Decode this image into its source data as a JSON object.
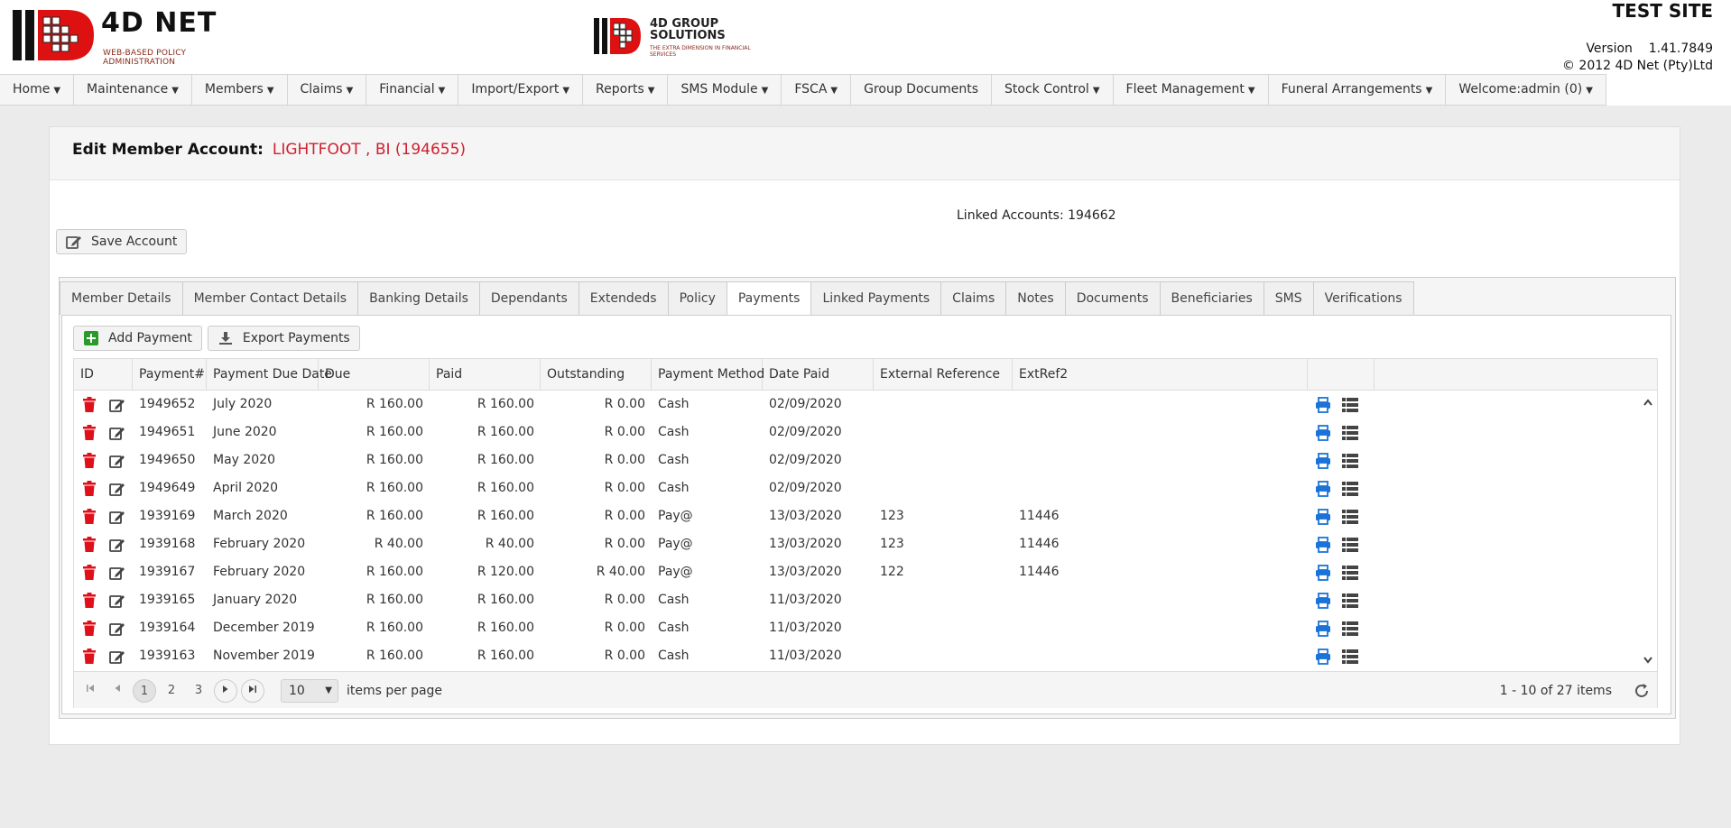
{
  "header": {
    "logo_text": "4D NET",
    "logo_tagline": "WEB-BASED POLICY ADMINISTRATION",
    "logo2_line1": "4D GROUP",
    "logo2_line2": "SOLUTIONS",
    "logo2_tagline": "THE EXTRA DIMENSION IN FINANCIAL SERVICES",
    "site_name": "TEST SITE",
    "version_label": "Version",
    "version_value": "1.41.7849",
    "copyright": "© 2012 4D Net (Pty)Ltd"
  },
  "nav": {
    "items": [
      {
        "label": "Home",
        "dropdown": true
      },
      {
        "label": "Maintenance",
        "dropdown": true
      },
      {
        "label": "Members",
        "dropdown": true
      },
      {
        "label": "Claims",
        "dropdown": true
      },
      {
        "label": "Financial",
        "dropdown": true
      },
      {
        "label": "Import/Export",
        "dropdown": true
      },
      {
        "label": "Reports",
        "dropdown": true
      },
      {
        "label": "SMS Module",
        "dropdown": true
      },
      {
        "label": "FSCA",
        "dropdown": true
      },
      {
        "label": "Group Documents",
        "dropdown": false
      },
      {
        "label": "Stock Control",
        "dropdown": true
      },
      {
        "label": "Fleet Management",
        "dropdown": true
      },
      {
        "label": "Funeral Arrangements",
        "dropdown": true
      },
      {
        "label": "Welcome:admin (0)",
        "dropdown": true
      }
    ]
  },
  "page": {
    "title": "Edit Member Account:",
    "member": "LIGHTFOOT , BI (194655)",
    "linked_label": "Linked Accounts:",
    "linked_value": "194662",
    "save_label": "Save Account"
  },
  "tabs": [
    {
      "label": "Member Details",
      "active": false
    },
    {
      "label": "Member Contact Details",
      "active": false
    },
    {
      "label": "Banking Details",
      "active": false
    },
    {
      "label": "Dependants",
      "active": false
    },
    {
      "label": "Extendeds",
      "active": false
    },
    {
      "label": "Policy",
      "active": false
    },
    {
      "label": "Payments",
      "active": true
    },
    {
      "label": "Linked Payments",
      "active": false
    },
    {
      "label": "Claims",
      "active": false
    },
    {
      "label": "Notes",
      "active": false
    },
    {
      "label": "Documents",
      "active": false
    },
    {
      "label": "Beneficiaries",
      "active": false
    },
    {
      "label": "SMS",
      "active": false
    },
    {
      "label": "Verifications",
      "active": false
    }
  ],
  "toolbar": {
    "add_label": "Add Payment",
    "export_label": "Export Payments"
  },
  "grid": {
    "columns": [
      "ID",
      "Payment#",
      "Payment Due Date",
      "Due",
      "Paid",
      "Outstanding",
      "Payment Method",
      "Date Paid",
      "External Reference",
      "ExtRef2"
    ],
    "rows": [
      [
        "1949652",
        "July 2020",
        "R 160.00",
        "R 160.00",
        "R 0.00",
        "Cash",
        "02/09/2020",
        "",
        ""
      ],
      [
        "1949651",
        "June 2020",
        "R 160.00",
        "R 160.00",
        "R 0.00",
        "Cash",
        "02/09/2020",
        "",
        ""
      ],
      [
        "1949650",
        "May 2020",
        "R 160.00",
        "R 160.00",
        "R 0.00",
        "Cash",
        "02/09/2020",
        "",
        ""
      ],
      [
        "1949649",
        "April 2020",
        "R 160.00",
        "R 160.00",
        "R 0.00",
        "Cash",
        "02/09/2020",
        "",
        ""
      ],
      [
        "1939169",
        "March 2020",
        "R 160.00",
        "R 160.00",
        "R 0.00",
        "Pay@",
        "13/03/2020",
        "123",
        "11446"
      ],
      [
        "1939168",
        "February 2020",
        "R 40.00",
        "R 40.00",
        "R 0.00",
        "Pay@",
        "13/03/2020",
        "123",
        "11446"
      ],
      [
        "1939167",
        "February 2020",
        "R 160.00",
        "R 120.00",
        "R 40.00",
        "Pay@",
        "13/03/2020",
        "122",
        "11446"
      ],
      [
        "1939165",
        "January 2020",
        "R 160.00",
        "R 160.00",
        "R 0.00",
        "Cash",
        "11/03/2020",
        "",
        ""
      ],
      [
        "1939164",
        "December 2019",
        "R 160.00",
        "R 160.00",
        "R 0.00",
        "Cash",
        "11/03/2020",
        "",
        ""
      ],
      [
        "1939163",
        "November 2019",
        "R 160.00",
        "R 160.00",
        "R 0.00",
        "Cash",
        "11/03/2020",
        "",
        ""
      ]
    ]
  },
  "pager": {
    "pages": [
      "1",
      "2",
      "3"
    ],
    "current": "1",
    "page_size": "10",
    "items_per_page_label": "items per page",
    "info": "1 - 10 of 27 items"
  },
  "colors": {
    "accent_red": "#d0202f",
    "delete_red": "#e0101a",
    "print_blue": "#1a73d9",
    "add_green": "#2a9a2a"
  },
  "icons": {
    "delete": "trash-icon",
    "edit": "edit-icon",
    "print": "print-icon",
    "details": "list-icon"
  }
}
